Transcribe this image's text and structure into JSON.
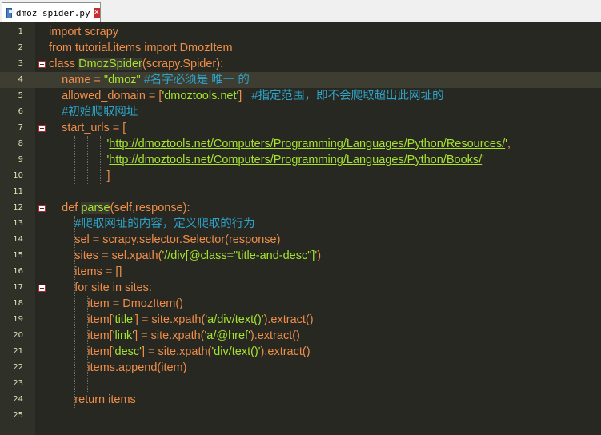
{
  "tab": {
    "filename": "dmoz_spider.py",
    "close_glyph": "×"
  },
  "colors": {
    "background": "#272822",
    "keyword": "#f08d49",
    "string": "#a6e22e",
    "comment": "#2fa3c8",
    "current_line": "#3e3d32"
  },
  "lines": [
    {
      "num": "1",
      "segs": [
        [
          "kw",
          "import"
        ],
        [
          "pl",
          " scrapy"
        ]
      ]
    },
    {
      "num": "2",
      "segs": [
        [
          "kw",
          "from"
        ],
        [
          "pl",
          " tutorial.items "
        ],
        [
          "kw",
          "import"
        ],
        [
          "pl",
          " DmozItem"
        ]
      ]
    },
    {
      "num": "3",
      "segs": [
        [
          "kw",
          "class"
        ],
        [
          "pl",
          " "
        ],
        [
          "cls",
          "DmozSpider"
        ],
        [
          "pl",
          "(scrapy.Spider):"
        ]
      ]
    },
    {
      "num": "4",
      "segs": [
        [
          "pl",
          "    name = "
        ],
        [
          "str",
          "\"dmoz\""
        ],
        [
          "pl",
          " "
        ],
        [
          "cmt",
          "#名字必须是 唯一 的"
        ]
      ]
    },
    {
      "num": "5",
      "segs": [
        [
          "pl",
          "    allowed_domain = ["
        ],
        [
          "str",
          "'dmoztools.net'"
        ],
        [
          "pl",
          "]   "
        ],
        [
          "cmt",
          "#指定范围，即不会爬取超出此网址的"
        ]
      ]
    },
    {
      "num": "6",
      "segs": [
        [
          "pl",
          "    "
        ],
        [
          "cmt",
          "#初始爬取网址"
        ]
      ]
    },
    {
      "num": "7",
      "segs": [
        [
          "pl",
          "    start_urls = ["
        ]
      ]
    },
    {
      "num": "8",
      "segs": [
        [
          "pl",
          "                  "
        ],
        [
          "str",
          "'"
        ],
        [
          "url",
          "http://dmoztools.net/Computers/Programming/Languages/Python/Resources/"
        ],
        [
          "str",
          "'"
        ],
        [
          "pl",
          ","
        ]
      ]
    },
    {
      "num": "9",
      "segs": [
        [
          "pl",
          "                  "
        ],
        [
          "str",
          "'"
        ],
        [
          "url",
          "http://dmoztools.net/Computers/Programming/Languages/Python/Books/"
        ],
        [
          "str",
          "'"
        ]
      ]
    },
    {
      "num": "10",
      "segs": [
        [
          "pl",
          "                  ]"
        ]
      ]
    },
    {
      "num": "11",
      "segs": []
    },
    {
      "num": "12",
      "segs": [
        [
          "pl",
          "    "
        ],
        [
          "kw",
          "def"
        ],
        [
          "pl",
          " "
        ],
        [
          "cls",
          "parse"
        ],
        [
          "pl",
          "(self,response):"
        ]
      ]
    },
    {
      "num": "13",
      "segs": [
        [
          "pl",
          "        "
        ],
        [
          "cmt",
          "#爬取网址的内容，定义爬取的行为"
        ]
      ]
    },
    {
      "num": "14",
      "segs": [
        [
          "pl",
          "        sel = scrapy.selector.Selector(response)"
        ]
      ]
    },
    {
      "num": "15",
      "segs": [
        [
          "pl",
          "        sites = sel.xpath("
        ],
        [
          "str",
          "'//div[@class=\"title-and-desc\"]'"
        ],
        [
          "pl",
          ")"
        ]
      ]
    },
    {
      "num": "16",
      "segs": [
        [
          "pl",
          "        items = []"
        ]
      ]
    },
    {
      "num": "17",
      "segs": [
        [
          "pl",
          "        "
        ],
        [
          "kw",
          "for"
        ],
        [
          "pl",
          " site "
        ],
        [
          "kw",
          "in"
        ],
        [
          "pl",
          " sites:"
        ]
      ]
    },
    {
      "num": "18",
      "segs": [
        [
          "pl",
          "            item = DmozItem()"
        ]
      ]
    },
    {
      "num": "19",
      "segs": [
        [
          "pl",
          "            item["
        ],
        [
          "str",
          "'title'"
        ],
        [
          "pl",
          "] = site.xpath("
        ],
        [
          "str",
          "'a/div/text()'"
        ],
        [
          "pl",
          ").extract()"
        ]
      ]
    },
    {
      "num": "20",
      "segs": [
        [
          "pl",
          "            item["
        ],
        [
          "str",
          "'link'"
        ],
        [
          "pl",
          "] = site.xpath("
        ],
        [
          "str",
          "'a/@href'"
        ],
        [
          "pl",
          ").extract()"
        ]
      ]
    },
    {
      "num": "21",
      "segs": [
        [
          "pl",
          "            item["
        ],
        [
          "str",
          "'desc'"
        ],
        [
          "pl",
          "] = site.xpath("
        ],
        [
          "str",
          "'div/text()'"
        ],
        [
          "pl",
          ").extract()"
        ]
      ]
    },
    {
      "num": "22",
      "segs": [
        [
          "pl",
          "            items.append(item)"
        ]
      ]
    },
    {
      "num": "23",
      "segs": []
    },
    {
      "num": "24",
      "segs": [
        [
          "pl",
          "        "
        ],
        [
          "kw",
          "return"
        ],
        [
          "pl",
          " items"
        ]
      ]
    },
    {
      "num": "25",
      "segs": []
    }
  ]
}
